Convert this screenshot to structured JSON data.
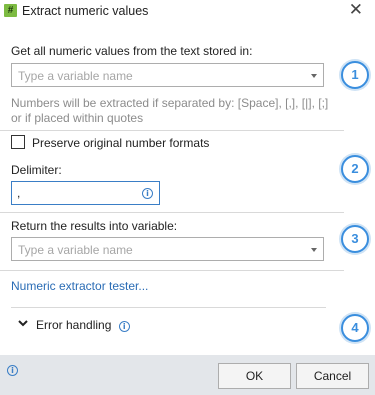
{
  "window": {
    "icon_glyph": "#",
    "title": "Extract numeric values",
    "close_glyph": "✕"
  },
  "source": {
    "label": "Get all numeric values from the text stored in:",
    "placeholder": "Type a variable name",
    "hint": "Numbers will be extracted if separated by: [Space], [,], [|], [;] or if placed within quotes"
  },
  "preserve": {
    "label": "Preserve original number formats",
    "checked": false
  },
  "delimiter": {
    "label": "Delimiter:",
    "value": ","
  },
  "result": {
    "label": "Return the results into variable:",
    "placeholder": "Type a variable name"
  },
  "tester_link": "Numeric extractor tester...",
  "error_handling": {
    "label": "Error handling",
    "expanded": false
  },
  "badges": [
    "1",
    "2",
    "3",
    "4"
  ],
  "info_glyph": "i",
  "footer": {
    "ok": "OK",
    "cancel": "Cancel"
  },
  "colors": {
    "accent": "#3a8ede",
    "link": "#2a6cb5",
    "app_icon": "#7dbb42",
    "footer_bg": "#e3e6ea"
  }
}
